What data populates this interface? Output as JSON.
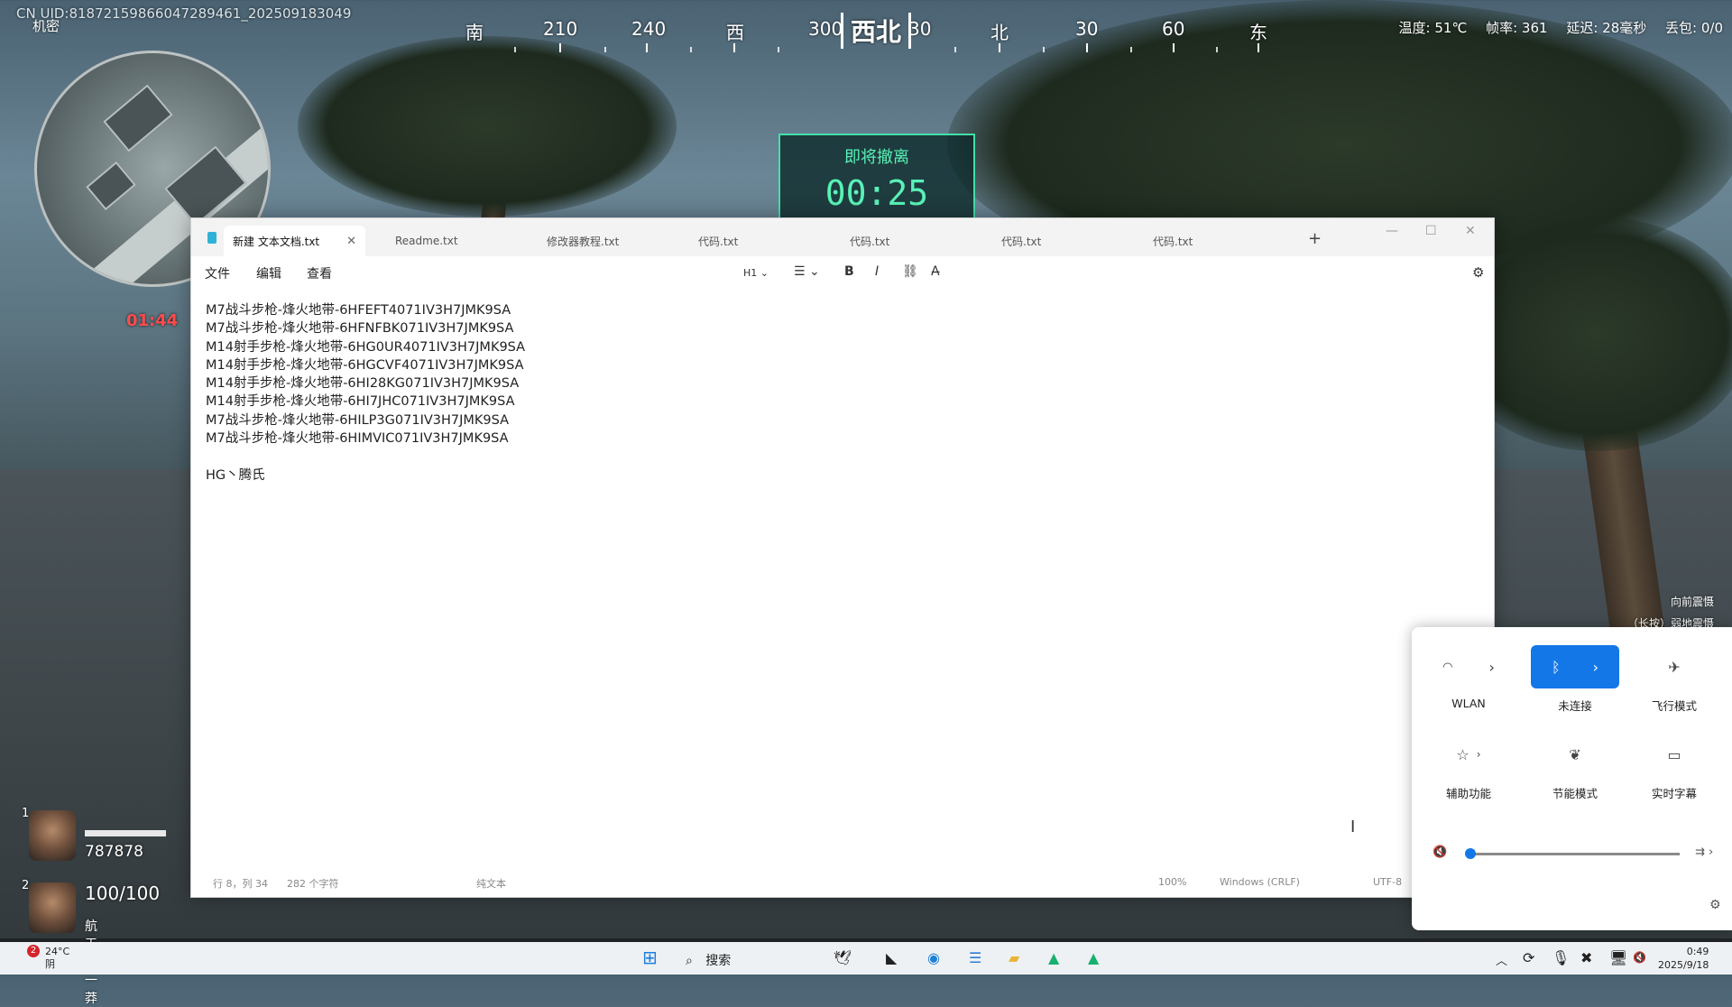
{
  "game": {
    "uid": "CN UID:818721598660472894​61_20250918​3049",
    "secret_label": "机密",
    "compass": {
      "labels": [
        "南",
        "210",
        "240",
        "西",
        "300",
        "30",
        "北",
        "30",
        "60",
        "东"
      ],
      "heading": "西北"
    },
    "stats": {
      "temp": "温度: 51℃",
      "fps": "帧率: 361",
      "latency": "延迟: 28毫秒",
      "loss": "丢包: 0/0"
    },
    "extraction": {
      "title": "即将撤离",
      "countdown": "00:25"
    },
    "red_timer": "01:44",
    "players": [
      {
        "num": "1",
        "value": "787878"
      },
      {
        "num": "2",
        "value": "100/100",
        "name": "航天第一莽"
      }
    ],
    "hints": [
      "向前震慑",
      "（长按）弱地震慑"
    ]
  },
  "notepad": {
    "tabs": [
      {
        "label": "新建 文本文档.txt",
        "active": true
      },
      {
        "label": "Readme.txt"
      },
      {
        "label": "修改器教程.txt"
      },
      {
        "label": "代码.txt"
      },
      {
        "label": "代码.txt"
      },
      {
        "label": "代码.txt"
      },
      {
        "label": "代码.txt"
      }
    ],
    "new_tab": "+",
    "menu": {
      "file": "文件",
      "edit": "编辑",
      "view": "查看"
    },
    "toolbar": {
      "heading": "H1",
      "list": "☰",
      "bold": "B",
      "italic": "I",
      "link": "⛓",
      "clear": "A̶"
    },
    "lines": [
      "M7战斗步枪-烽火地带-6HFEFT4071IV3H7JMK9SA",
      "M7战斗步枪-烽火地带-6HFNFBK071IV3H7JMK9SA",
      "M14射手步枪-烽火地带-6HG0UR4071IV3H7JMK9SA",
      "M14射手步枪-烽火地带-6HGCVF4071IV3H7JMK9SA",
      "M14射手步枪-烽火地带-6HI28KG071IV3H7JMK9SA",
      "M14射手步枪-烽火地带-6HI7JHC071IV3H7JMK9SA",
      "M7战斗步枪-烽火地带-6HILP3G071IV3H7JMK9SA",
      "M7战斗步枪-烽火地带-6HIMVIC071IV3H7JMK9SA",
      "",
      "HG丶腾氏"
    ],
    "status": {
      "position": "行 8，列 34",
      "chars": "282 个字符",
      "mode": "纯文本",
      "zoom": "100%",
      "eol": "Windows (CRLF)",
      "encoding": "UTF-8"
    }
  },
  "quick_settings": {
    "wlan": "WLAN",
    "bluetooth": "未连接",
    "airplane": "飞行模式",
    "accessibility": "辅助功能",
    "energy": "节能模式",
    "captions": "实时字幕",
    "volume_level": 0
  },
  "taskbar": {
    "weather_temp": "24°C",
    "weather_desc": "阴",
    "notif_count": "2",
    "search": "搜索",
    "time": "0:49",
    "date": "2025/9/18"
  }
}
